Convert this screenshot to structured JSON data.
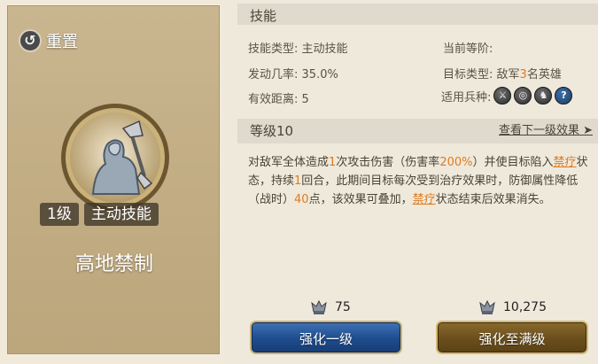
{
  "left": {
    "reset_label": "重置",
    "level_tag": "1级",
    "type_tag": "主动技能",
    "skill_name": "高地禁制"
  },
  "skill": {
    "section_title": "技能",
    "type_label": "技能类型:",
    "type_value": "主动技能",
    "current_level_label": "当前等阶:",
    "rate_label": "发动几率:",
    "rate_value": "35.0%",
    "target_label": "目标类型:",
    "target_prefix": "敌军",
    "target_count": "3",
    "target_suffix": "名英雄",
    "range_label": "有效距离:",
    "range_value": "5",
    "troops_label": "适用兵种:",
    "troop_icons": [
      "sword-icon",
      "bow-target-icon",
      "horse-icon",
      "question-icon"
    ]
  },
  "level": {
    "title": "等级10",
    "next_link": "查看下一级效果 ➤"
  },
  "description": {
    "p1": "对敌军全体造成",
    "n1": "1",
    "p2": "次攻击伤害（伤害率",
    "n2": "200%",
    "p3": "）并使目标陷入",
    "k1": "禁疗",
    "p4": "状态，持续",
    "n3": "1",
    "p5": "回合，此期间目标每次受到治疗效果时，防御属性降低（战时）",
    "n4": "40",
    "p6": "点，该效果可叠加，",
    "k2": "禁疗",
    "p7": "状态结束后效果消失。"
  },
  "costs": {
    "one_level": "75",
    "max_level": "10,275"
  },
  "buttons": {
    "upgrade_one": "强化一级",
    "upgrade_max": "强化至满级"
  },
  "colors": {
    "highlight": "#e07a1d",
    "button_blue": "#1e4c8d",
    "button_gold": "#6a4e1d"
  }
}
